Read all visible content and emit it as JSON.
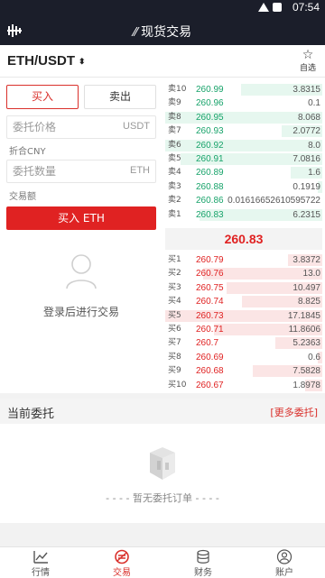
{
  "status": {
    "time": "07:54"
  },
  "header": {
    "title": "现货交易"
  },
  "pair": {
    "name": "ETH/USDT",
    "fav_label": "自选"
  },
  "trade": {
    "tab_buy": "买入",
    "tab_sell": "卖出",
    "price_placeholder": "委托价格",
    "price_unit": "USDT",
    "cny_label": "折合CNY",
    "qty_placeholder": "委托数量",
    "qty_unit": "ETH",
    "amount_label": "交易额",
    "buy_button": "买入 ETH",
    "login_text": "登录后进行交易"
  },
  "orderbook": {
    "asks": [
      {
        "label": "卖10",
        "price": "260.99",
        "qty": "3.8315",
        "depth": 0.52
      },
      {
        "label": "卖9",
        "price": "260.96",
        "qty": "0.1",
        "depth": 0.0
      },
      {
        "label": "卖8",
        "price": "260.95",
        "qty": "8.068",
        "depth": 1.0
      },
      {
        "label": "卖7",
        "price": "260.93",
        "qty": "2.0772",
        "depth": 0.26
      },
      {
        "label": "卖6",
        "price": "260.92",
        "qty": "8.0",
        "depth": 1.0
      },
      {
        "label": "卖5",
        "price": "260.91",
        "qty": "7.0816",
        "depth": 0.9
      },
      {
        "label": "卖4",
        "price": "260.89",
        "qty": "1.6",
        "depth": 0.2
      },
      {
        "label": "卖3",
        "price": "260.88",
        "qty": "0.1919",
        "depth": 0.03
      },
      {
        "label": "卖2",
        "price": "260.86",
        "qty": "0.01616652610595722",
        "depth": 0.0
      },
      {
        "label": "卖1",
        "price": "260.83",
        "qty": "6.2315",
        "depth": 0.78
      }
    ],
    "last_price": "260.83",
    "bids": [
      {
        "label": "买1",
        "price": "260.79",
        "qty": "3.8372",
        "depth": 0.22
      },
      {
        "label": "买2",
        "price": "260.76",
        "qty": "13.0",
        "depth": 0.76
      },
      {
        "label": "买3",
        "price": "260.75",
        "qty": "10.497",
        "depth": 0.61
      },
      {
        "label": "买4",
        "price": "260.74",
        "qty": "8.825",
        "depth": 0.51
      },
      {
        "label": "买5",
        "price": "260.73",
        "qty": "17.1845",
        "depth": 1.0
      },
      {
        "label": "买6",
        "price": "260.71",
        "qty": "11.8606",
        "depth": 0.69
      },
      {
        "label": "买7",
        "price": "260.7",
        "qty": "5.2363",
        "depth": 0.3
      },
      {
        "label": "买8",
        "price": "260.69",
        "qty": "0.6",
        "depth": 0.03
      },
      {
        "label": "买9",
        "price": "260.68",
        "qty": "7.5828",
        "depth": 0.44
      },
      {
        "label": "买10",
        "price": "260.67",
        "qty": "1.8978",
        "depth": 0.11
      }
    ]
  },
  "orders": {
    "title": "当前委托",
    "more": "[更多委托]",
    "empty_text": "- - - - 暂无委托订单 - - - -"
  },
  "nav": [
    {
      "label": "行情",
      "icon": "chart-icon"
    },
    {
      "label": "交易",
      "icon": "trade-icon"
    },
    {
      "label": "财务",
      "icon": "coins-icon"
    },
    {
      "label": "账户",
      "icon": "account-icon"
    }
  ],
  "colors": {
    "header_bg": "#1b1e2a",
    "buy_red": "#e02222",
    "ask_green": "#17a36a",
    "ask_depth": "#e6f7ef",
    "bid_depth": "#fbe5e5"
  }
}
